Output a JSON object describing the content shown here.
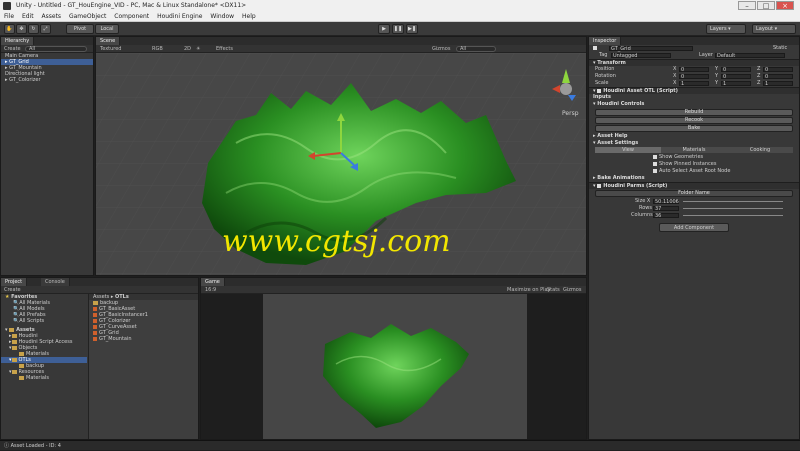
{
  "window": {
    "title": "Unity - Untitled - GT_HouEngine_VID - PC, Mac & Linux Standalone* <DX11>"
  },
  "menu": [
    "File",
    "Edit",
    "Assets",
    "GameObject",
    "Component",
    "Houdini Engine",
    "Window",
    "Help"
  ],
  "toolbar": {
    "pivot": "Pivot",
    "local": "Local",
    "layers": "Layers",
    "layout": "Layout"
  },
  "hierarchy": {
    "tab": "Hierarchy",
    "create": "Create",
    "search": "All",
    "items": [
      "Main Camera",
      "GT_Grid",
      "GT_Mountain",
      "Directional light",
      "GT_Colorizer"
    ]
  },
  "scene": {
    "tab": "Scene",
    "textured": "Textured",
    "rgb": "RGB",
    "mode2d": "2D",
    "effects": "Effects",
    "gizmos": "Gizmos",
    "search": "All",
    "persp": "Persp"
  },
  "watermark": "www.cgtsj.com",
  "inspector": {
    "tab": "Inspector",
    "object_name": "GT_Grid",
    "static": "Static",
    "tag_label": "Tag",
    "tag_value": "Untagged",
    "layer_label": "Layer",
    "layer_value": "Default",
    "transform": "Transform",
    "position": {
      "label": "Position",
      "x": "0",
      "y": "0",
      "z": "0"
    },
    "rotation": {
      "label": "Rotation",
      "x": "0",
      "y": "0",
      "z": "0"
    },
    "scale": {
      "label": "Scale",
      "x": "1",
      "y": "1",
      "z": "1"
    },
    "axis": {
      "x": "X",
      "y": "Y",
      "z": "Z"
    },
    "houdini_otl": "Houdini Asset OTL (Script)",
    "inputs": "Inputs",
    "controls": "Houdini Controls",
    "rebuild": "Rebuild",
    "recook": "Recook",
    "bake": "Bake",
    "asset_help": "Asset Help",
    "asset_settings": "Asset Settings",
    "settings_tabs": [
      "View",
      "Materials",
      "Cooking"
    ],
    "checks": [
      "Show Geometries",
      "Show Pinned Instances",
      "Auto Select Asset Root Node"
    ],
    "bake_animations": "Bake Animations",
    "houdini_parms": "Houdini Parms (Script)",
    "folder_name": "Folder Name",
    "size": {
      "label": "Size X",
      "value": "50.11006"
    },
    "rows": {
      "label": "Rows",
      "value": "37"
    },
    "columns": {
      "label": "Columns",
      "value": "36"
    },
    "add_component": "Add Component"
  },
  "project": {
    "tabs": [
      "Project",
      "Console"
    ],
    "create": "Create",
    "favorites_label": "Favorites",
    "favorites": [
      "All Materials",
      "All Models",
      "All Prefabs",
      "All Scripts"
    ],
    "assets_label": "Assets",
    "tree": [
      "Houdini",
      "Houdini Script Access",
      "Objects",
      "Materials",
      "OTLs",
      "backup",
      "Resources",
      "Materials"
    ],
    "breadcrumb_root": "Assets",
    "breadcrumb_leaf": "OTLs",
    "files": [
      "backup",
      "GT_BasicAsset",
      "GT_BasicInstancer1",
      "GT_Colorizer",
      "GT_CurveAsset",
      "GT_Grid",
      "GT_Mountain"
    ]
  },
  "game": {
    "tab": "Game",
    "aspect": "16:9",
    "maximize": "Maximize on Play",
    "stats": "Stats",
    "gizmos": "Gizmos"
  },
  "status": {
    "text": "Asset Loaded - ID: 4"
  },
  "colors": {
    "terrain": "#2f9a2a",
    "selection": "#3e5f96",
    "watermark": "#f2e600"
  }
}
